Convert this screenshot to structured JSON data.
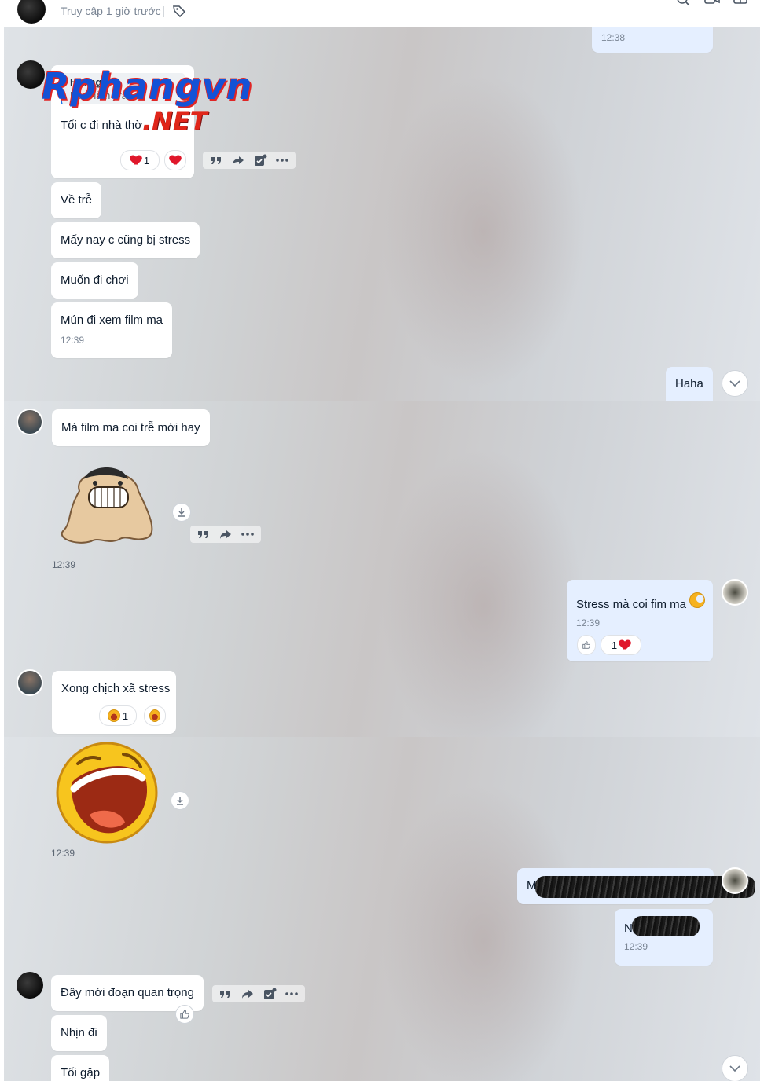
{
  "header": {
    "status": "Truy cập 1 giờ trước"
  },
  "panel1": {
    "top_time": "12:38",
    "quote": {
      "name": "Hoàng",
      "text": "Ủa c làm j ra"
    },
    "msg1": {
      "text": "Tối c đi nhà thờ",
      "reaction_count": "1"
    },
    "msg2": "Về trễ",
    "msg3": "Mấy nay c cũng bị stress",
    "msg4": "Muốn đi chơi",
    "msg5": {
      "text": "Mún đi xem film ma",
      "time": "12:39"
    },
    "mine1": "Haha"
  },
  "panel2": {
    "msg1": "Mà film ma coi trễ mới hay",
    "sticker_time": "12:39",
    "mine1": {
      "text": "Stress mà coi fim ma",
      "time": "12:39",
      "reaction_count": "1"
    },
    "msg2": {
      "text": "Xong chịch xã stress",
      "reaction_count": "1"
    }
  },
  "panel3": {
    "sticker_time": "12:39",
    "mine1_prefix": "M",
    "mine2": {
      "prefix": "N",
      "time": "12:39"
    },
    "msg1": "Đây mới đoạn quan trọng",
    "msg2": "Nhịn đi",
    "msg3": "Tối gặp"
  },
  "watermark": {
    "line1": "Rphangvn",
    "line2": ".NET"
  },
  "icons": [
    "tag-icon",
    "quote-icon",
    "forward-icon",
    "task-icon",
    "more-icon",
    "download-icon",
    "chevron-down-icon",
    "like-icon",
    "heart-icon",
    "laugh-icon"
  ]
}
